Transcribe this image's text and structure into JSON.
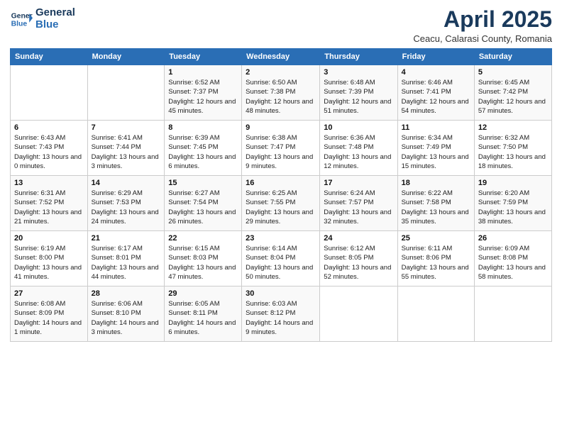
{
  "header": {
    "logo_line1": "General",
    "logo_line2": "Blue",
    "month_title": "April 2025",
    "subtitle": "Ceacu, Calarasi County, Romania"
  },
  "weekdays": [
    "Sunday",
    "Monday",
    "Tuesday",
    "Wednesday",
    "Thursday",
    "Friday",
    "Saturday"
  ],
  "weeks": [
    [
      {
        "day": "",
        "info": ""
      },
      {
        "day": "",
        "info": ""
      },
      {
        "day": "1",
        "info": "Sunrise: 6:52 AM\nSunset: 7:37 PM\nDaylight: 12 hours and 45 minutes."
      },
      {
        "day": "2",
        "info": "Sunrise: 6:50 AM\nSunset: 7:38 PM\nDaylight: 12 hours and 48 minutes."
      },
      {
        "day": "3",
        "info": "Sunrise: 6:48 AM\nSunset: 7:39 PM\nDaylight: 12 hours and 51 minutes."
      },
      {
        "day": "4",
        "info": "Sunrise: 6:46 AM\nSunset: 7:41 PM\nDaylight: 12 hours and 54 minutes."
      },
      {
        "day": "5",
        "info": "Sunrise: 6:45 AM\nSunset: 7:42 PM\nDaylight: 12 hours and 57 minutes."
      }
    ],
    [
      {
        "day": "6",
        "info": "Sunrise: 6:43 AM\nSunset: 7:43 PM\nDaylight: 13 hours and 0 minutes."
      },
      {
        "day": "7",
        "info": "Sunrise: 6:41 AM\nSunset: 7:44 PM\nDaylight: 13 hours and 3 minutes."
      },
      {
        "day": "8",
        "info": "Sunrise: 6:39 AM\nSunset: 7:45 PM\nDaylight: 13 hours and 6 minutes."
      },
      {
        "day": "9",
        "info": "Sunrise: 6:38 AM\nSunset: 7:47 PM\nDaylight: 13 hours and 9 minutes."
      },
      {
        "day": "10",
        "info": "Sunrise: 6:36 AM\nSunset: 7:48 PM\nDaylight: 13 hours and 12 minutes."
      },
      {
        "day": "11",
        "info": "Sunrise: 6:34 AM\nSunset: 7:49 PM\nDaylight: 13 hours and 15 minutes."
      },
      {
        "day": "12",
        "info": "Sunrise: 6:32 AM\nSunset: 7:50 PM\nDaylight: 13 hours and 18 minutes."
      }
    ],
    [
      {
        "day": "13",
        "info": "Sunrise: 6:31 AM\nSunset: 7:52 PM\nDaylight: 13 hours and 21 minutes."
      },
      {
        "day": "14",
        "info": "Sunrise: 6:29 AM\nSunset: 7:53 PM\nDaylight: 13 hours and 24 minutes."
      },
      {
        "day": "15",
        "info": "Sunrise: 6:27 AM\nSunset: 7:54 PM\nDaylight: 13 hours and 26 minutes."
      },
      {
        "day": "16",
        "info": "Sunrise: 6:25 AM\nSunset: 7:55 PM\nDaylight: 13 hours and 29 minutes."
      },
      {
        "day": "17",
        "info": "Sunrise: 6:24 AM\nSunset: 7:57 PM\nDaylight: 13 hours and 32 minutes."
      },
      {
        "day": "18",
        "info": "Sunrise: 6:22 AM\nSunset: 7:58 PM\nDaylight: 13 hours and 35 minutes."
      },
      {
        "day": "19",
        "info": "Sunrise: 6:20 AM\nSunset: 7:59 PM\nDaylight: 13 hours and 38 minutes."
      }
    ],
    [
      {
        "day": "20",
        "info": "Sunrise: 6:19 AM\nSunset: 8:00 PM\nDaylight: 13 hours and 41 minutes."
      },
      {
        "day": "21",
        "info": "Sunrise: 6:17 AM\nSunset: 8:01 PM\nDaylight: 13 hours and 44 minutes."
      },
      {
        "day": "22",
        "info": "Sunrise: 6:15 AM\nSunset: 8:03 PM\nDaylight: 13 hours and 47 minutes."
      },
      {
        "day": "23",
        "info": "Sunrise: 6:14 AM\nSunset: 8:04 PM\nDaylight: 13 hours and 50 minutes."
      },
      {
        "day": "24",
        "info": "Sunrise: 6:12 AM\nSunset: 8:05 PM\nDaylight: 13 hours and 52 minutes."
      },
      {
        "day": "25",
        "info": "Sunrise: 6:11 AM\nSunset: 8:06 PM\nDaylight: 13 hours and 55 minutes."
      },
      {
        "day": "26",
        "info": "Sunrise: 6:09 AM\nSunset: 8:08 PM\nDaylight: 13 hours and 58 minutes."
      }
    ],
    [
      {
        "day": "27",
        "info": "Sunrise: 6:08 AM\nSunset: 8:09 PM\nDaylight: 14 hours and 1 minute."
      },
      {
        "day": "28",
        "info": "Sunrise: 6:06 AM\nSunset: 8:10 PM\nDaylight: 14 hours and 3 minutes."
      },
      {
        "day": "29",
        "info": "Sunrise: 6:05 AM\nSunset: 8:11 PM\nDaylight: 14 hours and 6 minutes."
      },
      {
        "day": "30",
        "info": "Sunrise: 6:03 AM\nSunset: 8:12 PM\nDaylight: 14 hours and 9 minutes."
      },
      {
        "day": "",
        "info": ""
      },
      {
        "day": "",
        "info": ""
      },
      {
        "day": "",
        "info": ""
      }
    ]
  ]
}
